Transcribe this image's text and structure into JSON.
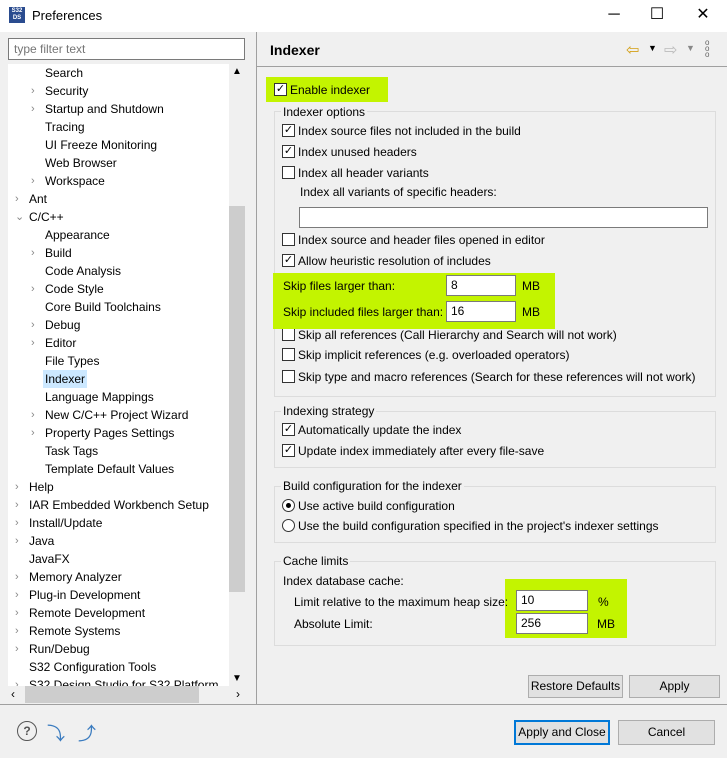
{
  "window": {
    "title": "Preferences",
    "logo": "S32 DS",
    "minimize": "─",
    "maximize": "☐",
    "close": "✕"
  },
  "filter": {
    "placeholder": "type filter text"
  },
  "tree": [
    {
      "label": "Search",
      "level": 1,
      "exp": ""
    },
    {
      "label": "Security",
      "level": 1,
      "exp": ">"
    },
    {
      "label": "Startup and Shutdown",
      "level": 1,
      "exp": ">"
    },
    {
      "label": "Tracing",
      "level": 1,
      "exp": ""
    },
    {
      "label": "UI Freeze Monitoring",
      "level": 1,
      "exp": ""
    },
    {
      "label": "Web Browser",
      "level": 1,
      "exp": ""
    },
    {
      "label": "Workspace",
      "level": 1,
      "exp": ">"
    },
    {
      "label": "Ant",
      "level": 0,
      "exp": ">"
    },
    {
      "label": "C/C++",
      "level": 0,
      "exp": "v"
    },
    {
      "label": "Appearance",
      "level": 1,
      "exp": ""
    },
    {
      "label": "Build",
      "level": 1,
      "exp": ">"
    },
    {
      "label": "Code Analysis",
      "level": 1,
      "exp": ""
    },
    {
      "label": "Code Style",
      "level": 1,
      "exp": ">"
    },
    {
      "label": "Core Build Toolchains",
      "level": 1,
      "exp": ""
    },
    {
      "label": "Debug",
      "level": 1,
      "exp": ">"
    },
    {
      "label": "Editor",
      "level": 1,
      "exp": ">"
    },
    {
      "label": "File Types",
      "level": 1,
      "exp": ""
    },
    {
      "label": "Indexer",
      "level": 1,
      "exp": "",
      "selected": true
    },
    {
      "label": "Language Mappings",
      "level": 1,
      "exp": ""
    },
    {
      "label": "New C/C++ Project Wizard",
      "level": 1,
      "exp": ">"
    },
    {
      "label": "Property Pages Settings",
      "level": 1,
      "exp": ">"
    },
    {
      "label": "Task Tags",
      "level": 1,
      "exp": ""
    },
    {
      "label": "Template Default Values",
      "level": 1,
      "exp": ""
    },
    {
      "label": "Help",
      "level": 0,
      "exp": ">"
    },
    {
      "label": "IAR Embedded Workbench Setup",
      "level": 0,
      "exp": ">"
    },
    {
      "label": "Install/Update",
      "level": 0,
      "exp": ">"
    },
    {
      "label": "Java",
      "level": 0,
      "exp": ">"
    },
    {
      "label": "JavaFX",
      "level": 0,
      "exp": ""
    },
    {
      "label": "Memory Analyzer",
      "level": 0,
      "exp": ">"
    },
    {
      "label": "Plug-in Development",
      "level": 0,
      "exp": ">"
    },
    {
      "label": "Remote Development",
      "level": 0,
      "exp": ">"
    },
    {
      "label": "Remote Systems",
      "level": 0,
      "exp": ">"
    },
    {
      "label": "Run/Debug",
      "level": 0,
      "exp": ">"
    },
    {
      "label": "S32 Configuration Tools",
      "level": 0,
      "exp": ""
    },
    {
      "label": "S32 Design Studio for S32 Platform",
      "level": 0,
      "exp": ">"
    }
  ],
  "page": {
    "title": "Indexer",
    "enable_indexer": {
      "label": "Enable indexer",
      "checked": true
    },
    "options": {
      "title": "Indexer options",
      "not_in_build": {
        "label": "Index source files not included in the build",
        "checked": true
      },
      "unused_headers": {
        "label": "Index unused headers",
        "checked": true
      },
      "all_variants": {
        "label": "Index all header variants",
        "checked": false
      },
      "specific_label": "Index all variants of specific headers:",
      "specific_value": "",
      "opened_in_editor": {
        "label": "Index source and header files opened in editor",
        "checked": false
      },
      "heuristic": {
        "label": "Allow heuristic resolution of includes",
        "checked": true
      },
      "skip_files_label": "Skip files larger than:",
      "skip_files_value": "8",
      "skip_files_unit": "MB",
      "skip_included_label": "Skip included files larger than:",
      "skip_included_value": "16",
      "skip_included_unit": "MB",
      "skip_all_refs": {
        "label": "Skip all references (Call Hierarchy and Search will not work)",
        "checked": false
      },
      "skip_implicit": {
        "label": "Skip implicit references (e.g. overloaded operators)",
        "checked": false
      },
      "skip_type_macro": {
        "label": "Skip type and macro references (Search for these references will not work)",
        "checked": false
      }
    },
    "strategy": {
      "title": "Indexing strategy",
      "auto_update": {
        "label": "Automatically update the index",
        "checked": true
      },
      "update_on_save": {
        "label": "Update index immediately after every file-save",
        "checked": true
      }
    },
    "build_config": {
      "title": "Build configuration for the indexer",
      "active": {
        "label": "Use active build configuration",
        "selected": true
      },
      "project": {
        "label": "Use the build configuration specified in the project's indexer settings",
        "selected": false
      }
    },
    "cache": {
      "title": "Cache limits",
      "db_label": "Index database cache:",
      "relative_label": "Limit relative to the maximum heap size:",
      "relative_value": "10",
      "relative_unit": "%",
      "absolute_label": "Absolute Limit:",
      "absolute_value": "256",
      "absolute_unit": "MB"
    },
    "restore_defaults": "Restore Defaults",
    "apply": "Apply"
  },
  "footer": {
    "apply_close": "Apply and Close",
    "cancel": "Cancel"
  }
}
